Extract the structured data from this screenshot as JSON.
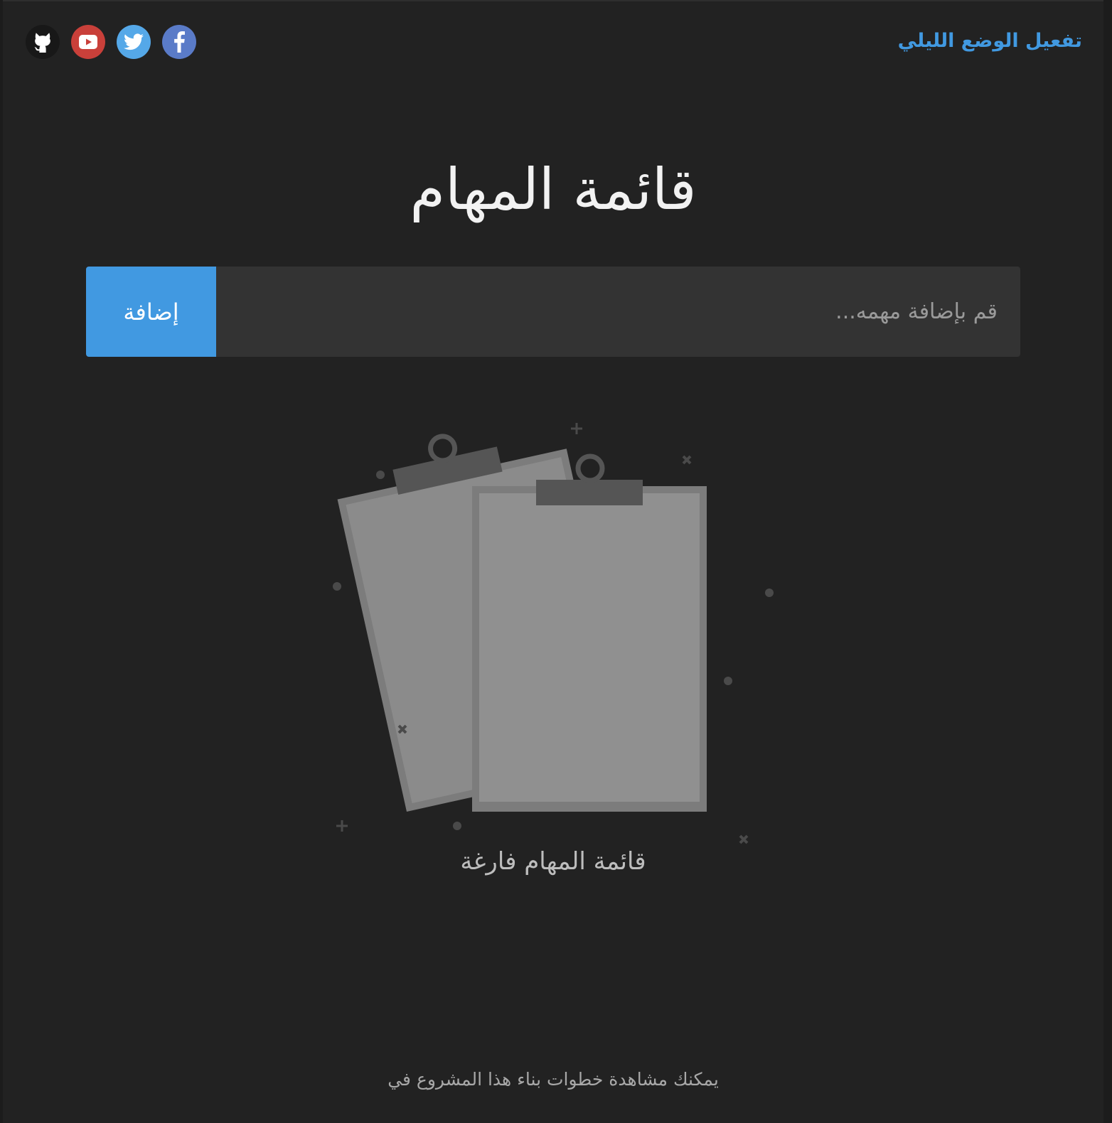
{
  "header": {
    "dark_mode_link": "تفعيل الوضع الليلي",
    "social": [
      {
        "name": "github",
        "icon": "github-icon",
        "color": "#181818"
      },
      {
        "name": "youtube",
        "icon": "youtube-icon",
        "color": "#c9403a"
      },
      {
        "name": "twitter",
        "icon": "twitter-icon",
        "color": "#55a8e8"
      },
      {
        "name": "facebook",
        "icon": "facebook-icon",
        "color": "#5a7bc8"
      }
    ]
  },
  "main": {
    "title": "قائمة المهام",
    "task_input": {
      "placeholder": "قم بإضافة مهمه...",
      "value": ""
    },
    "add_button_label": "إضافة",
    "empty_illustration_icon": "empty-clipboards-icon",
    "empty_message": "قائمة المهام فارغة"
  },
  "footer": {
    "text": "يمكنك مشاهدة خطوات بناء هذا المشروع في"
  },
  "colors": {
    "accent": "#4199e1",
    "background": "#222222",
    "input_background": "#333333"
  }
}
